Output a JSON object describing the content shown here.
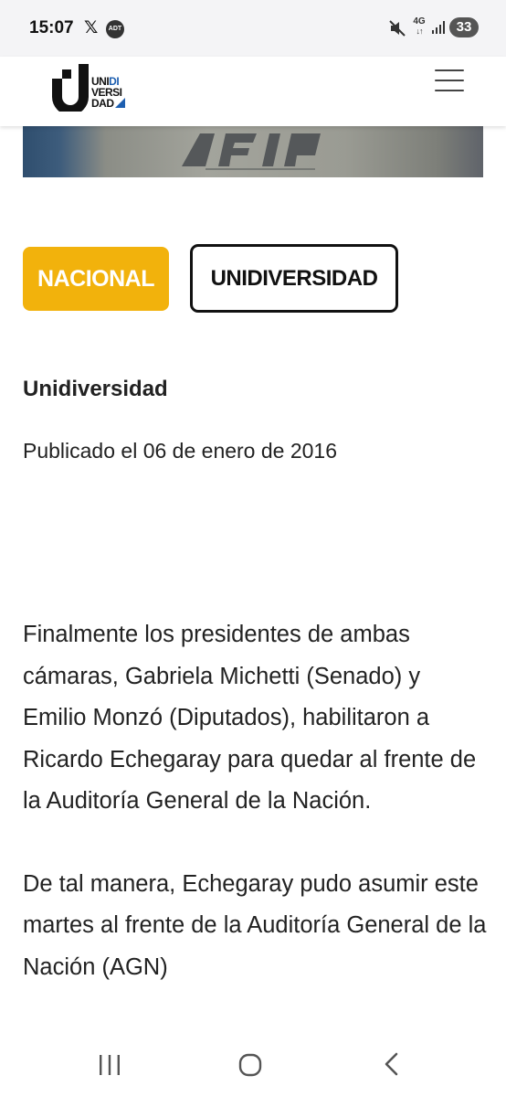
{
  "status_bar": {
    "time": "15:07",
    "x_label": "𝕏",
    "adt_label": "ADT",
    "network": "4G",
    "battery": "33"
  },
  "header": {
    "logo_line1_a": "UNI",
    "logo_line1_b": "DI",
    "logo_line2": "VERSI",
    "logo_line3": "DAD",
    "menu_icon": "hamburger-icon"
  },
  "tags": {
    "category": "NACIONAL",
    "source": "UNIDIVERSIDAD"
  },
  "colors": {
    "category_bg": "#f2b20c",
    "logo_blue": "#1d5fb0"
  },
  "article": {
    "author": "Unidiversidad",
    "published": "Publicado el 06 de enero de 2016",
    "paragraphs": [
      "Finalmente los presidentes de ambas cámaras, Gabriela Michetti (Senado) y Emilio Monzó (Diputados), habilitaron a Ricardo Echegaray para quedar al frente de la Auditoría General de la Nación.",
      "De tal manera, Echegaray pudo asumir este martes al frente de la Auditoría General de la Nación (AGN)"
    ]
  }
}
